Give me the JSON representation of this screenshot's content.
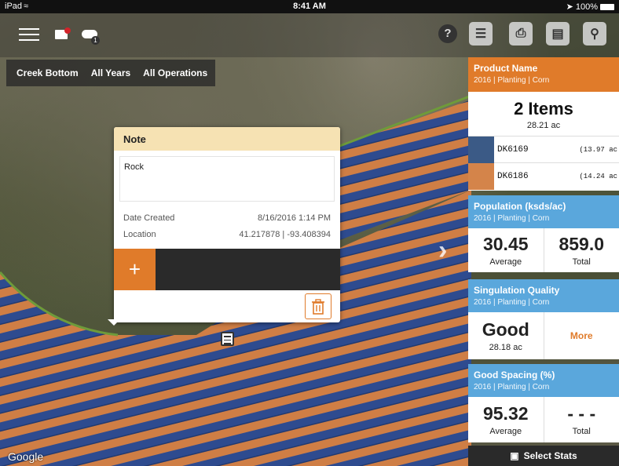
{
  "status": {
    "device": "iPad",
    "wifi_icon": "wifi-icon",
    "time": "8:41 AM",
    "battery": "100%"
  },
  "toolbar": {
    "menu_icon": "hamburger-icon",
    "message_icon": "message-icon",
    "cloud_badge": "1",
    "buttons": [
      "help-icon",
      "layers-icon",
      "print-icon",
      "document-icon",
      "zoom-extents-icon"
    ]
  },
  "filters": [
    "Creek Bottom",
    "All Years",
    "All Operations"
  ],
  "note": {
    "title": "Note",
    "text": "Rock",
    "date_label": "Date Created",
    "date_value": "8/16/2016 1:14 PM",
    "location_label": "Location",
    "location_value": "41.217878 | -93.408394",
    "add_label": "+"
  },
  "map": {
    "attribution": "Google",
    "chevron": "›"
  },
  "cards": {
    "product": {
      "title": "Product Name",
      "subtitle": "2016 | Planting | Corn",
      "items_title": "2 Items",
      "items_area": "28.21 ac",
      "rows": [
        {
          "name": "DK6169",
          "area": "(13.97 ac",
          "color": "#3b5a86"
        },
        {
          "name": "DK6186",
          "area": "(14.24 ac",
          "color": "#d4844a"
        }
      ]
    },
    "population": {
      "title": "Population (ksds/ac)",
      "subtitle": "2016 | Planting | Corn",
      "avg_value": "30.45",
      "avg_label": "Average",
      "total_value": "859.0",
      "total_label": "Total"
    },
    "singulation": {
      "title": "Singulation Quality",
      "subtitle": "2016 | Planting | Corn",
      "value": "Good",
      "value_sub": "28.18 ac",
      "more": "More"
    },
    "spacing": {
      "title": "Good Spacing (%)",
      "subtitle": "2016 | Planting | Corn",
      "avg_value": "95.32",
      "avg_label": "Average",
      "total_value": "- - -",
      "total_label": "Total"
    }
  },
  "select_stats": "Select Stats",
  "colors": {
    "accent": "#e07b2a",
    "card_blue": "#5aa7dc",
    "note_header": "#f6e2b3"
  }
}
